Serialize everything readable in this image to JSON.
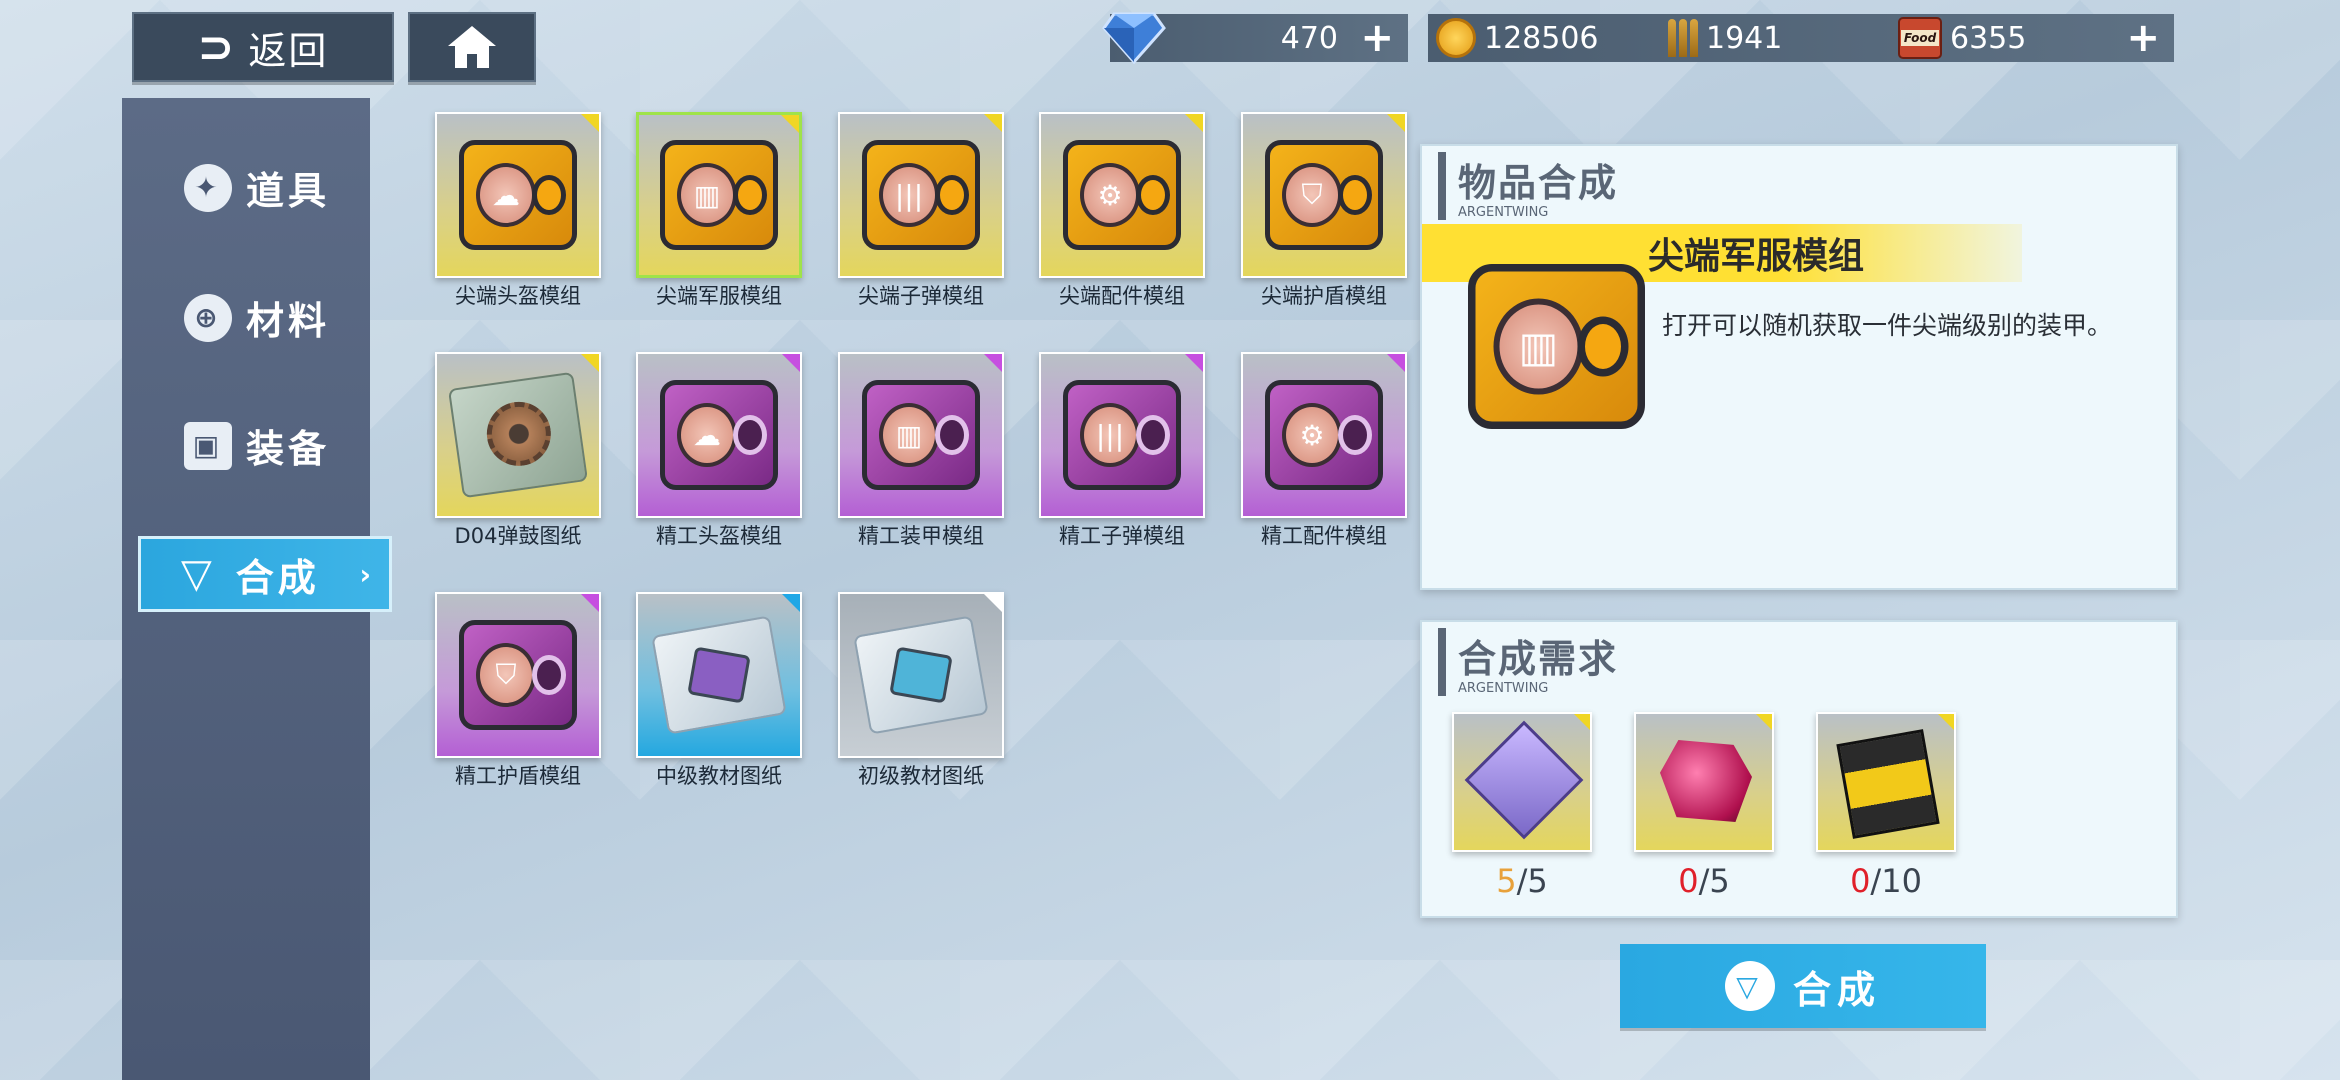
{
  "topbar": {
    "back_label": "返回",
    "gem_count": "470",
    "coins": "128506",
    "ammo": "1941",
    "food": "6355",
    "food_badge": "Food"
  },
  "sidebar": {
    "items": [
      {
        "label": "道具"
      },
      {
        "label": "材料"
      },
      {
        "label": "装备"
      },
      {
        "label": "合成"
      }
    ]
  },
  "grid": {
    "items": [
      {
        "label": "尖端头盔模组",
        "rarity": "gold",
        "icon": "helmet-module-icon"
      },
      {
        "label": "尖端军服模组",
        "rarity": "gold",
        "icon": "uniform-module-icon",
        "selected": true
      },
      {
        "label": "尖端子弹模组",
        "rarity": "gold",
        "icon": "bullet-module-icon"
      },
      {
        "label": "尖端配件模组",
        "rarity": "gold",
        "icon": "parts-module-icon"
      },
      {
        "label": "尖端护盾模组",
        "rarity": "gold",
        "icon": "shield-module-icon"
      },
      {
        "label": "D04弹鼓图纸",
        "rarity": "gold",
        "icon": "drum-blueprint-icon"
      },
      {
        "label": "精工头盔模组",
        "rarity": "purple",
        "icon": "helmet-module-icon"
      },
      {
        "label": "精工装甲模组",
        "rarity": "purple",
        "icon": "armor-module-icon"
      },
      {
        "label": "精工子弹模组",
        "rarity": "purple",
        "icon": "bullet-module-icon"
      },
      {
        "label": "精工配件模组",
        "rarity": "purple",
        "icon": "parts-module-icon"
      },
      {
        "label": "精工护盾模组",
        "rarity": "purple",
        "icon": "shield-module-icon"
      },
      {
        "label": "中级教材图纸",
        "rarity": "blue",
        "icon": "textbook-blueprint-icon"
      },
      {
        "label": "初级教材图纸",
        "rarity": "gray",
        "icon": "textbook-blueprint-icon"
      }
    ]
  },
  "detail": {
    "title": "物品合成",
    "subtitle": "ARGENTWING",
    "item_name": "尖端军服模组",
    "description": "打开可以随机获取一件尖端级别的装甲。"
  },
  "requirements": {
    "title": "合成需求",
    "subtitle": "ARGENTWING",
    "items": [
      {
        "have": "5",
        "need": "/5",
        "have_color": "#e8a13a",
        "icon": "emblem-material-icon"
      },
      {
        "have": "0",
        "need": "/5",
        "have_color": "#e0202a",
        "icon": "crystal-material-icon"
      },
      {
        "have": "0",
        "need": "/10",
        "have_color": "#e0202a",
        "icon": "manual-material-icon"
      }
    ]
  },
  "craft_button": {
    "label": "合成"
  }
}
